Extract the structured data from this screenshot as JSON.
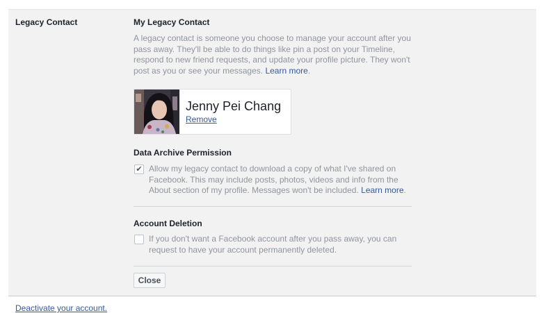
{
  "section": {
    "label": "Legacy Contact"
  },
  "legacy": {
    "heading": "My Legacy Contact",
    "description": "A legacy contact is someone you choose to manage your account after you pass away. They'll be able to do things like pin a post on your Timeline, respond to new friend requests, and update your profile picture. They won't post as you or see your messages.",
    "learn_more": "Learn more",
    "contact_name": "Jenny Pei Chang",
    "remove_label": "Remove"
  },
  "archive": {
    "heading": "Data Archive Permission",
    "checked": true,
    "text": "Allow my legacy contact to download a copy of what I've shared on Facebook. This may include posts, photos, videos and info from the About section of my profile. Messages won't be included.",
    "learn_more": "Learn more"
  },
  "deletion": {
    "heading": "Account Deletion",
    "checked": false,
    "text": "If you don't want a Facebook account after you pass away, you can request to have your account permanently deleted."
  },
  "close_label": "Close",
  "deactivate_label": "Deactivate your account."
}
